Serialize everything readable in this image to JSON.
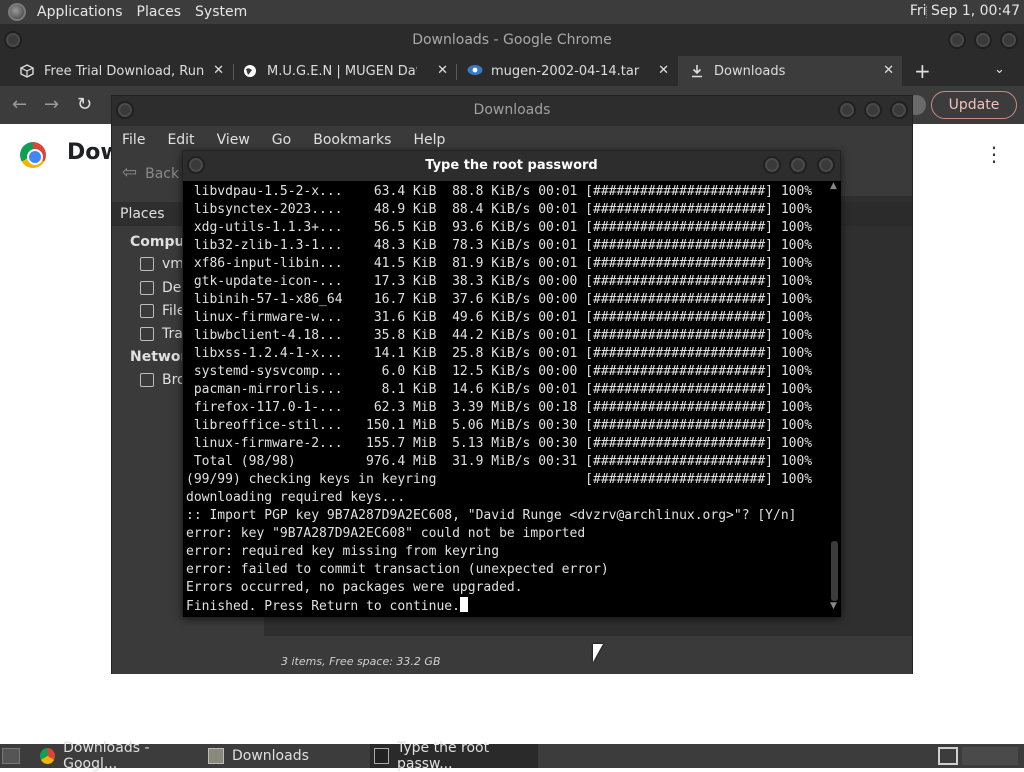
{
  "top_panel": {
    "menus": [
      "Applications",
      "Places",
      "System"
    ],
    "clock": "Fri Sep  1, 00:47"
  },
  "chrome": {
    "window_title": "Downloads - Google Chrome",
    "tabs": [
      {
        "label": "Free Trial Download, Run W",
        "icon": "box-icon"
      },
      {
        "label": "M.U.G.E.N | MUGEN Databa",
        "icon": "globe-icon"
      },
      {
        "label": "mugen-2002-04-14.tar",
        "icon": "eye-icon"
      },
      {
        "label": "Downloads",
        "icon": "download-icon"
      }
    ],
    "tab_close": "✕",
    "new_tab": "+",
    "tab_search": "⌄",
    "update_button": "Update",
    "page_heading": "Dow",
    "menu_glyph": "⋮"
  },
  "file_manager": {
    "title": "Downloads",
    "menubar": [
      "File",
      "Edit",
      "View",
      "Go",
      "Bookmarks",
      "Help"
    ],
    "back_label": "Back",
    "sidebar": {
      "header": "Places",
      "computer_section": "Compute",
      "computer_items": [
        "vm",
        "Des",
        "File",
        "Tra"
      ],
      "network_section": "Network",
      "network_items": [
        "Bro"
      ]
    },
    "status": "3 items, Free space: 33.2 GB"
  },
  "terminal": {
    "title": "Type the root password",
    "lines": [
      " libvdpau-1.5-2-x...    63.4 KiB  88.8 KiB/s 00:01 [######################] 100%",
      " libsynctex-2023....    48.9 KiB  88.4 KiB/s 00:01 [######################] 100%",
      " xdg-utils-1.1.3+...    56.5 KiB  93.6 KiB/s 00:01 [######################] 100%",
      " lib32-zlib-1.3-1...    48.3 KiB  78.3 KiB/s 00:01 [######################] 100%",
      " xf86-input-libin...    41.5 KiB  81.9 KiB/s 00:01 [######################] 100%",
      " gtk-update-icon-...    17.3 KiB  38.3 KiB/s 00:00 [######################] 100%",
      " libinih-57-1-x86_64    16.7 KiB  37.6 KiB/s 00:00 [######################] 100%",
      " linux-firmware-w...    31.6 KiB  49.6 KiB/s 00:01 [######################] 100%",
      " libwbclient-4.18...    35.8 KiB  44.2 KiB/s 00:01 [######################] 100%",
      " libxss-1.2.4-1-x...    14.1 KiB  25.8 KiB/s 00:01 [######################] 100%",
      " systemd-sysvcomp...     6.0 KiB  12.5 KiB/s 00:00 [######################] 100%",
      " pacman-mirrorlis...     8.1 KiB  14.6 KiB/s 00:01 [######################] 100%",
      " firefox-117.0-1-...    62.3 MiB  3.39 MiB/s 00:18 [######################] 100%",
      " libreoffice-stil...   150.1 MiB  5.06 MiB/s 00:30 [######################] 100%",
      " linux-firmware-2...   155.7 MiB  5.13 MiB/s 00:30 [######################] 100%",
      " Total (98/98)         976.4 MiB  31.9 MiB/s 00:31 [######################] 100%",
      "(99/99) checking keys in keyring                   [######################] 100%",
      "downloading required keys...",
      ":: Import PGP key 9B7A287D9A2EC608, \"David Runge <dvzrv@archlinux.org>\"? [Y/n]",
      "error: key \"9B7A287D9A2EC608\" could not be imported",
      "error: required key missing from keyring",
      "error: failed to commit transaction (unexpected error)",
      "Errors occurred, no packages were upgraded.",
      "Finished. Press Return to continue."
    ]
  },
  "taskbar": {
    "tasks": [
      {
        "label": "Downloads - Googl...",
        "icon": "chrome-icon"
      },
      {
        "label": "Downloads",
        "icon": "folder-icon"
      },
      {
        "label": "Type the root passw...",
        "icon": "terminal-icon"
      }
    ]
  }
}
